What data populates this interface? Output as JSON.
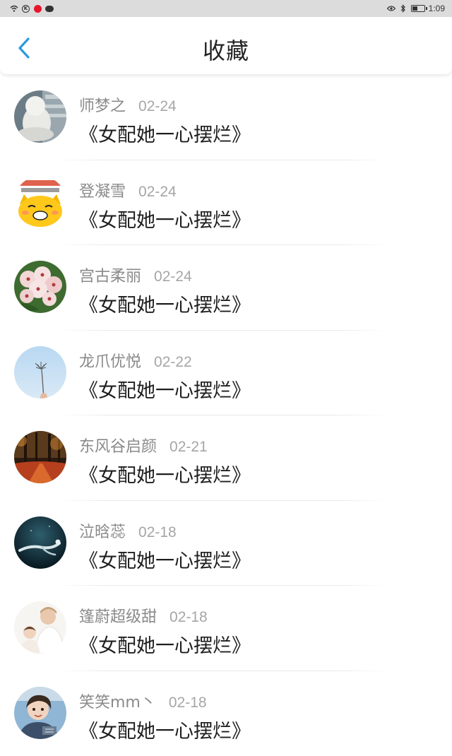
{
  "status_bar": {
    "time": "1:09",
    "left_icons": [
      "wifi-icon",
      "circle-k-icon",
      "weibo-icon",
      "chat-bubble-icon"
    ],
    "right_icons": [
      "eye-icon",
      "bluetooth-icon",
      "battery-icon"
    ]
  },
  "header": {
    "title": "收藏",
    "back_icon": "chevron-left-icon",
    "accent_color": "#2b9ae0"
  },
  "items": [
    {
      "user": "师梦之",
      "date": "02-24",
      "title": "《女配她一心摆烂》",
      "avatar": "white-cat"
    },
    {
      "user": "登凝雪",
      "date": "02-24",
      "title": "《女配她一心摆烂》",
      "avatar": "yellow-cat-emoji"
    },
    {
      "user": "宫古柔丽",
      "date": "02-24",
      "title": "《女配她一心摆烂》",
      "avatar": "flowers"
    },
    {
      "user": "龙爪优悦",
      "date": "02-22",
      "title": "《女配她一心摆烂》",
      "avatar": "dandelion-sky"
    },
    {
      "user": "东风谷启颜",
      "date": "02-21",
      "title": "《女配她一心摆烂》",
      "avatar": "autumn-forest"
    },
    {
      "user": "泣晗蕊",
      "date": "02-18",
      "title": "《女配她一心摆烂》",
      "avatar": "underwater"
    },
    {
      "user": "篷蔚超级甜",
      "date": "02-18",
      "title": "《女配她一心摆烂》",
      "avatar": "people-photo"
    },
    {
      "user": "笑笑mm丶",
      "date": "02-18",
      "title": "《女配她一心摆烂》",
      "avatar": "boy-photo"
    }
  ]
}
